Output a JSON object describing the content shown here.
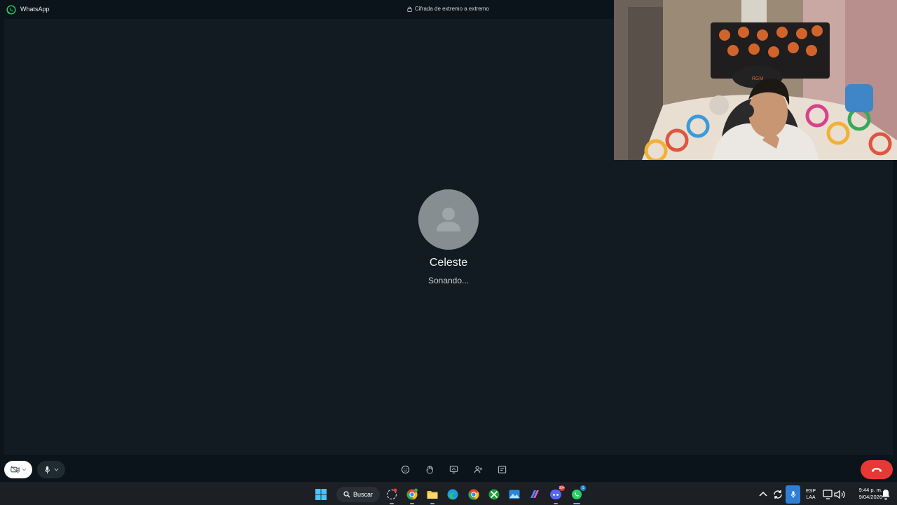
{
  "window": {
    "app_name": "WhatsApp",
    "encryption_note": "Cifrada de extremo a extremo"
  },
  "call": {
    "contact_name": "Celeste",
    "status": "Sonando..."
  },
  "colors": {
    "background": "#0b141a",
    "call_area": "#111b21",
    "end_call": "#e53935",
    "whatsapp_green": "#25d366",
    "taskbar": "#1c1f24"
  },
  "controls": {
    "left": [
      "camera-off-icon",
      "microphone-icon"
    ],
    "center": [
      "emoji-reaction-icon",
      "raise-hand-icon",
      "share-screen-icon",
      "add-participant-icon",
      "chat-icon"
    ],
    "end": "end-call-icon"
  },
  "taskbar": {
    "search_label": "Buscar",
    "apps": [
      "windows-start-icon",
      "copilot-icon",
      "chrome-profile-icon",
      "file-explorer-icon",
      "edge-icon",
      "chrome-icon",
      "xbox-icon",
      "photos-icon",
      "copilot-app-icon",
      "discord-icon",
      "whatsapp-icon"
    ],
    "badges": {
      "discord": "99+",
      "whatsapp": "1"
    },
    "language_top": "ESP",
    "language_bottom": "LAA",
    "time": "9:44 p. m.",
    "date": "9/04/2026"
  }
}
